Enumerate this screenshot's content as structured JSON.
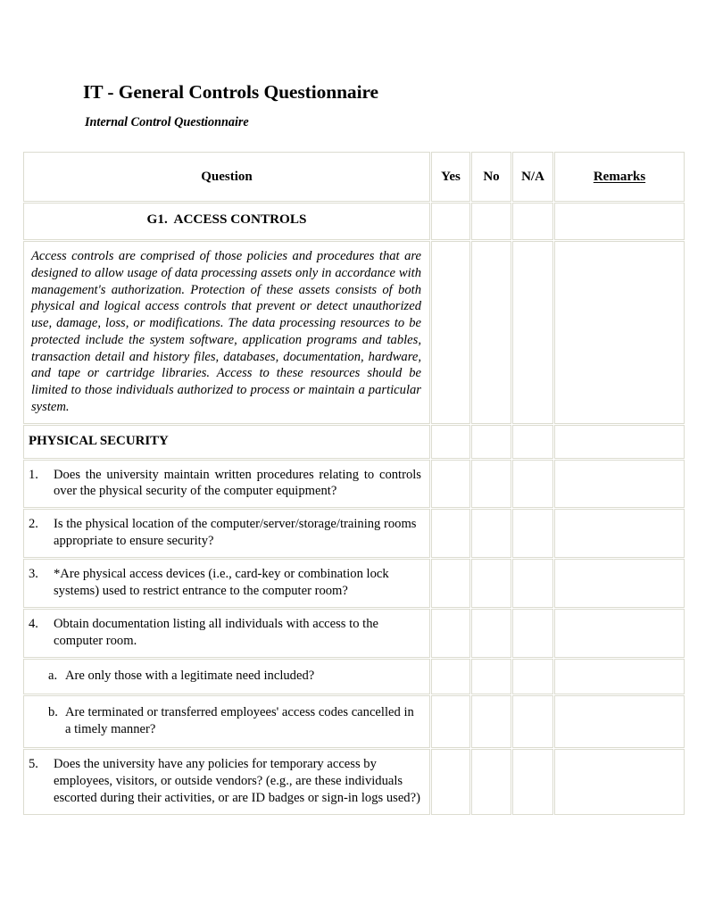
{
  "document": {
    "title": "IT - General Controls Questionnaire",
    "subtitle": "Internal Control Questionnaire"
  },
  "table": {
    "headers": {
      "question": "Question",
      "yes": "Yes",
      "no": "No",
      "na": "N/A",
      "remarks": "Remarks"
    },
    "section_title": "G1.  ACCESS CONTROLS",
    "intro_paragraph": "Access controls are comprised of those policies and procedures that are designed to allow usage of data processing assets only in accordance with management's authorization.  Protection of these assets consists of both physical and logical access controls that prevent or detect unauthorized use, damage, loss, or modifications.  The data processing resources to be protected include the system software, application programs and tables, transaction detail and history files, databases, documentation, hardware, and tape or cartridge libraries.  Access to these resources should be limited to those individuals authorized to process or maintain a particular system.",
    "subsection_title": "PHYSICAL SECURITY",
    "questions": [
      {
        "number": "1.",
        "text": "Does the university maintain written procedures relating to controls over the physical security of the computer equipment?",
        "justify": true,
        "yes": "",
        "no": "",
        "na": "",
        "remarks": ""
      },
      {
        "number": "2.",
        "text": "Is the physical location of the computer/server/storage/training rooms appropriate to ensure security?",
        "justify": false,
        "yes": "",
        "no": "",
        "na": "",
        "remarks": ""
      },
      {
        "number": "3.",
        "text": "*Are physical access devices (i.e., card-key or combination lock systems) used to restrict entrance to the computer room?",
        "justify": false,
        "yes": "",
        "no": "",
        "na": "",
        "remarks": ""
      },
      {
        "number": "4.",
        "text": "Obtain documentation listing all individuals with access to the computer room.",
        "justify": false,
        "yes": "",
        "no": "",
        "na": "",
        "remarks": ""
      },
      {
        "number": "5.",
        "text": "Does the university have any policies for temporary access by employees, visitors, or outside vendors? (e.g., are these individuals escorted during their activities, or are ID badges or sign-in logs used?)",
        "justify": false,
        "yes": "",
        "no": "",
        "na": "",
        "remarks": ""
      }
    ],
    "sub_questions": [
      {
        "letter": "a.",
        "text": "Are only those with a legitimate need included?",
        "yes": "",
        "no": "",
        "na": "",
        "remarks": ""
      },
      {
        "letter": "b.",
        "text": "Are terminated or transferred employees' access codes cancelled in a timely manner?",
        "yes": "",
        "no": "",
        "na": "",
        "remarks": ""
      }
    ]
  },
  "colors": {
    "page_background": "#ffffff",
    "text": "#000000",
    "cell_border": "#dcdcd0"
  }
}
